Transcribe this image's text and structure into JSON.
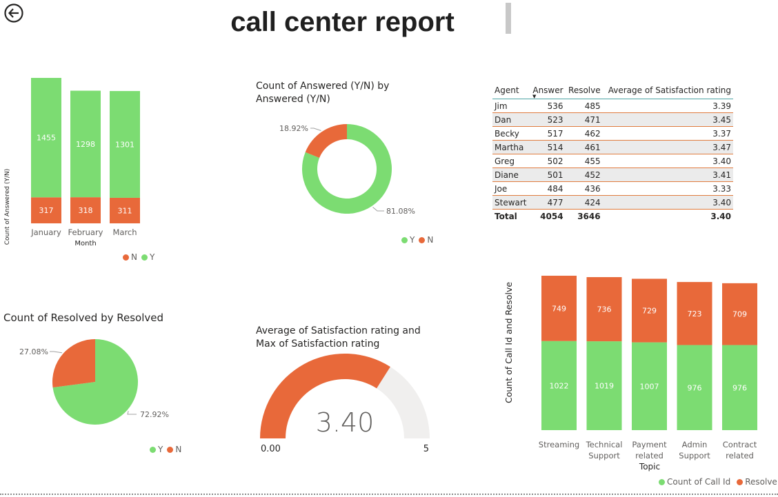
{
  "page": {
    "title": "call center report"
  },
  "colors": {
    "Y": "#7cdc72",
    "N": "#e8693a",
    "gauge_track": "#f0efee",
    "text": "#252423"
  },
  "chart_data": [
    {
      "id": "monthly",
      "type": "bar",
      "stacked": true,
      "title": "",
      "xlabel": "Month",
      "ylabel": "Count of Answered (Y/N)",
      "categories": [
        "January",
        "February",
        "March"
      ],
      "series": [
        {
          "name": "N",
          "values": [
            317,
            318,
            311
          ],
          "color": "#e8693a"
        },
        {
          "name": "Y",
          "values": [
            1455,
            1298,
            1301
          ],
          "color": "#7cdc72"
        }
      ],
      "ylim": [
        0,
        1772
      ],
      "legend": [
        "N",
        "Y"
      ],
      "legend_position": "bottom"
    },
    {
      "id": "answered",
      "type": "pie",
      "donut": true,
      "title": "Count of Answered (Y/N) by Answered (Y/N)",
      "title_lines": [
        "Count of Answered (Y/N) by",
        "Answered (Y/N)"
      ],
      "slices": [
        {
          "name": "Y",
          "pct_label": "81.08%",
          "value": 81.08,
          "color": "#7cdc72"
        },
        {
          "name": "N",
          "pct_label": "18.92%",
          "value": 18.92,
          "color": "#e8693a"
        }
      ],
      "legend": [
        "Y",
        "N"
      ],
      "legend_position": "bottom"
    },
    {
      "id": "agents",
      "type": "table",
      "columns": [
        "Agent",
        "Answer",
        "Resolve",
        "Average of Satisfaction rating"
      ],
      "rows": [
        [
          "Jim",
          "536",
          "485",
          "3.39"
        ],
        [
          "Dan",
          "523",
          "471",
          "3.45"
        ],
        [
          "Becky",
          "517",
          "462",
          "3.37"
        ],
        [
          "Martha",
          "514",
          "461",
          "3.47"
        ],
        [
          "Greg",
          "502",
          "455",
          "3.40"
        ],
        [
          "Diane",
          "501",
          "452",
          "3.41"
        ],
        [
          "Joe",
          "484",
          "436",
          "3.33"
        ],
        [
          "Stewart",
          "477",
          "424",
          "3.40"
        ]
      ],
      "total": [
        "Total",
        "4054",
        "3646",
        "3.40"
      ],
      "sorted_by": "Answer"
    },
    {
      "id": "resolved",
      "type": "pie",
      "title": "Count of Resolved by Resolved",
      "slices": [
        {
          "name": "Y",
          "pct_label": "72.92%",
          "value": 72.92,
          "color": "#7cdc72"
        },
        {
          "name": "N",
          "pct_label": "27.08%",
          "value": 27.08,
          "color": "#e8693a"
        }
      ],
      "legend": [
        "Y",
        "N"
      ],
      "legend_position": "bottom"
    },
    {
      "id": "gauge",
      "type": "gauge",
      "title": "Average of Satisfaction rating and Max of Satisfaction rating",
      "title_lines": [
        "Average of Satisfaction rating and",
        "Max of Satisfaction rating"
      ],
      "value": 3.4,
      "value_label": "3.40",
      "min": 0,
      "max": 5,
      "min_label": "0.00",
      "max_label": "5"
    },
    {
      "id": "topic",
      "type": "bar",
      "stacked": true,
      "title": "",
      "xlabel": "Topic",
      "ylabel": "Count of Call Id and Resolve",
      "categories": [
        "Streaming",
        "Technical Support",
        "Payment related",
        "Admin Support",
        "Contract related"
      ],
      "category_lines": [
        [
          "Streaming"
        ],
        [
          "Technical",
          "Support"
        ],
        [
          "Payment",
          "related"
        ],
        [
          "Admin",
          "Support"
        ],
        [
          "Contract",
          "related"
        ]
      ],
      "series": [
        {
          "name": "Count of Call Id",
          "values": [
            1022,
            1019,
            1007,
            976,
            976
          ],
          "color": "#7cdc72"
        },
        {
          "name": "Resolve",
          "values": [
            749,
            736,
            729,
            723,
            709
          ],
          "color": "#e8693a"
        }
      ],
      "ylim": [
        0,
        1771
      ],
      "legend": [
        "Count of Call Id",
        "Resolve"
      ],
      "legend_position": "bottom-right"
    }
  ]
}
